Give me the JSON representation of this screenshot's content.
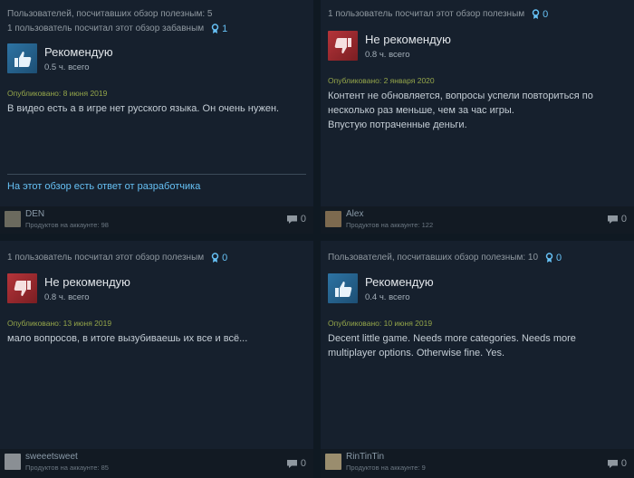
{
  "reviews": [
    {
      "helpful_line": "Пользователей, посчитавших обзор полезным: 5",
      "funny_line": "1 пользователь посчитал этот обзор забавным",
      "award_count": "1",
      "verdict": "Рекомендую",
      "recommended": true,
      "hours": "0.5 ч. всего",
      "posted": "Опубликовано: 8 июня 2019",
      "text": "В видео есть а в игре нет русского языка. Он очень нужен.",
      "dev_response": "На этот обзор есть ответ от разработчика",
      "author": "DEN",
      "products": "Продуктов на аккаунте: 98",
      "comments": "0",
      "avatar_color": "#6b6a5e"
    },
    {
      "helpful_line": "1 пользователь посчитал этот обзор полезным",
      "award_count": "0",
      "verdict": "Не рекомендую",
      "recommended": false,
      "hours": "0.8 ч. всего",
      "posted": "Опубликовано: 2 января 2020",
      "text": "Контент не обновляется, вопросы успели повториться по несколько раз меньше, чем за час игры.\nВпустую потраченные деньги.",
      "author": "Alex",
      "products": "Продуктов на аккаунте: 122",
      "comments": "0",
      "avatar_color": "#7d6a4f"
    },
    {
      "helpful_line": "1 пользователь посчитал этот обзор полезным",
      "award_count": "0",
      "verdict": "Не рекомендую",
      "recommended": false,
      "hours": "0.8 ч. всего",
      "posted": "Опубликовано: 13 июня 2019",
      "text": "мало вопросов, в итоге вызубиваешь их все и всё...",
      "author": "sweeetsweet",
      "products": "Продуктов на аккаунте: 85",
      "comments": "0",
      "avatar_color": "#8a8f94"
    },
    {
      "helpful_line": "Пользователей, посчитавших обзор полезным: 10",
      "award_count": "0",
      "verdict": "Рекомендую",
      "recommended": true,
      "hours": "0.4 ч. всего",
      "posted": "Опубликовано: 10 июня 2019",
      "text": "Decent little game. Needs more categories. Needs more multiplayer options. Otherwise fine. Yes.",
      "author": "RinTinTin",
      "products": "Продуктов на аккаунте: 9",
      "comments": "0",
      "avatar_color": "#9a8d6e"
    }
  ]
}
